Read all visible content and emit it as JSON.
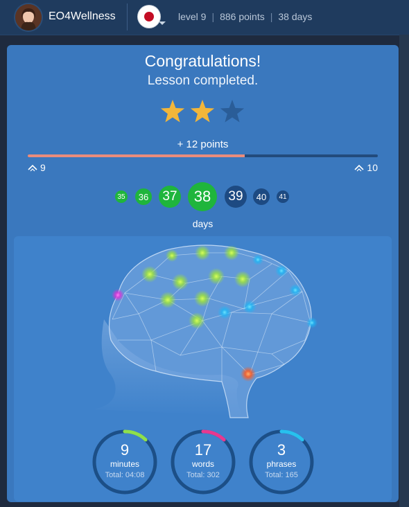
{
  "header": {
    "username": "EO4Wellness",
    "flag_icon": "japan-flag-icon",
    "stats": {
      "level": "level 9",
      "points": "886 points",
      "days": "38 days"
    },
    "separator": "|"
  },
  "lesson": {
    "title": "Congratulations!",
    "subtitle": "Lesson completed.",
    "stars": {
      "earned": 2,
      "total": 3
    },
    "points_gained": "+ 12 points",
    "level_progress": 0.62,
    "level_from": "9",
    "level_to": "10"
  },
  "days": {
    "label": "days",
    "items": [
      {
        "value": "35",
        "status": "done"
      },
      {
        "value": "36",
        "status": "done"
      },
      {
        "value": "37",
        "status": "done"
      },
      {
        "value": "38",
        "status": "done"
      },
      {
        "value": "39",
        "status": "future"
      },
      {
        "value": "40",
        "status": "future"
      },
      {
        "value": "41",
        "status": "future"
      }
    ]
  },
  "metrics": [
    {
      "value": "9",
      "unit": "minutes",
      "total": "Total: 04:08",
      "color": "#8fe04b",
      "fraction": 0.12
    },
    {
      "value": "17",
      "unit": "words",
      "total": "Total: 302",
      "color": "#e8388f",
      "fraction": 0.12
    },
    {
      "value": "3",
      "unit": "phrases",
      "total": "Total: 165",
      "color": "#27c1ee",
      "fraction": 0.12
    }
  ],
  "colors": {
    "card": "#3a78be",
    "done_day": "#1fb53c",
    "future_day": "#1d4a82",
    "progress": "#ea8c7c",
    "star_gold": "#f2b63a",
    "star_empty": "#2a5d98"
  }
}
